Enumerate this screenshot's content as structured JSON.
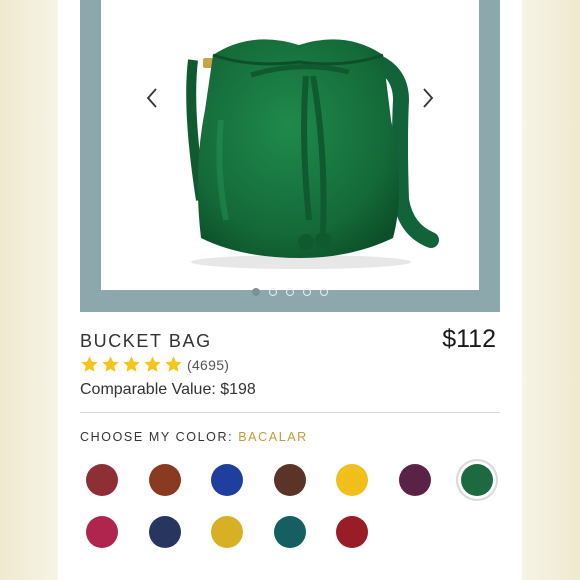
{
  "product": {
    "name": "BUCKET BAG",
    "price": "$112",
    "rating_count": "(4695)",
    "rating_value": 5,
    "comparable_value": "Comparable Value: $198"
  },
  "carousel": {
    "slide_count": 5,
    "active_slide": 1
  },
  "color_picker": {
    "label": "CHOOSE MY COLOR: ",
    "selected": "BACALAR"
  },
  "swatches": [
    {
      "color": "#8e2f36"
    },
    {
      "color": "#8b3a22"
    },
    {
      "color": "#1f3f9e"
    },
    {
      "color": "#5a3426"
    },
    {
      "color": "#f0bf1b"
    },
    {
      "color": "#5a2346"
    },
    {
      "color": "#1e6a40",
      "selected": true
    },
    {
      "color": "#b0254e"
    },
    {
      "color": "#27365f"
    },
    {
      "color": "#d7b024"
    },
    {
      "color": "#155e62"
    },
    {
      "color": "#991c27"
    }
  ],
  "colors": {
    "hero_frame": "#8ca8ac",
    "star": "#f5c518",
    "accent": "#c49a3c"
  }
}
